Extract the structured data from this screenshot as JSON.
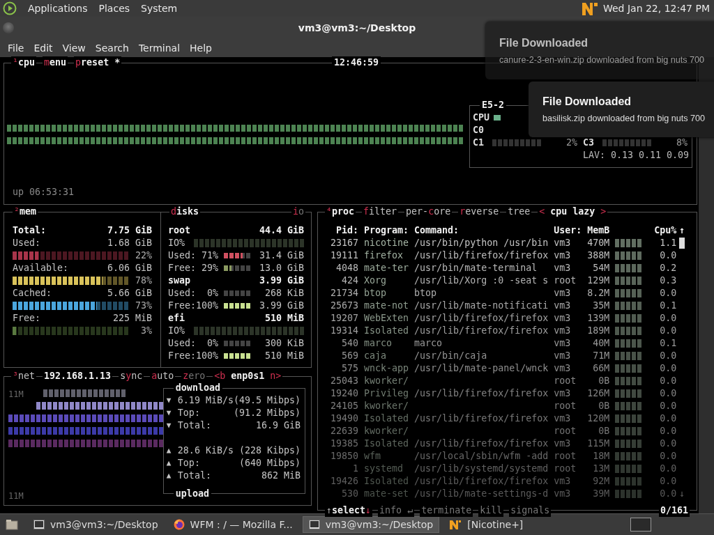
{
  "top_panel": {
    "menus": [
      "Applications",
      "Places",
      "System"
    ],
    "clock": "Wed Jan 22, 12:47 PM"
  },
  "window": {
    "title": "vm3@vm3:~/Desktop",
    "menu": [
      "File",
      "Edit",
      "View",
      "Search",
      "Terminal",
      "Help"
    ]
  },
  "cpu": {
    "tabs": [
      {
        "key": "¹",
        "post": "cpu"
      },
      {
        "key": "m",
        "post": "enu"
      },
      {
        "key": "p",
        "post": "reset *"
      }
    ],
    "clock": "12:46:59",
    "uptime": "up 06:53:31",
    "info": {
      "model": "E5-2",
      "cpu_label": "CPU",
      "c0_label": "C0",
      "cores": [
        {
          "label": "C1",
          "reading": "2%"
        },
        {
          "label": "C3",
          "reading": "8%"
        }
      ],
      "load": "LAV: 0.13 0.11 0.09"
    }
  },
  "notifications": [
    {
      "title": "File Downloaded",
      "body": "canure-2-3-en-win.zip downloaded from big nuts 700"
    },
    {
      "title": "File Downloaded",
      "body": "basilisk.zip downloaded from big nuts 700"
    }
  ],
  "mem": {
    "tab": {
      "key": "²",
      "post": "mem"
    },
    "rows": [
      {
        "kind": "total",
        "label": "Total:",
        "value": "7.75 GiB"
      },
      {
        "kind": "stat",
        "label": "Used:",
        "value": "1.68 GiB"
      },
      {
        "kind": "meter",
        "level": 0.22,
        "reading": "22%",
        "color": "#a8344a"
      },
      {
        "kind": "stat",
        "label": "Available:",
        "value": "6.06 GiB"
      },
      {
        "kind": "meter",
        "level": 0.78,
        "reading": "78%",
        "color": "#d9c25a"
      },
      {
        "kind": "stat",
        "label": "Cached:",
        "value": "5.66 GiB"
      },
      {
        "kind": "meter",
        "level": 0.73,
        "reading": "73%",
        "color": "#4aa6de"
      },
      {
        "kind": "stat",
        "label": "Free:",
        "value": "225 MiB"
      },
      {
        "kind": "meter",
        "level": 0.03,
        "reading": "3%",
        "color": "#5a7a40"
      }
    ]
  },
  "disks": {
    "tab": {
      "key": "d",
      "post": "isks"
    },
    "io_tab": {
      "key": "i",
      "post": "o"
    },
    "rows": [
      {
        "kind": "header",
        "label": "root",
        "value": "44.4 GiB"
      },
      {
        "kind": "io",
        "label": "IO%"
      },
      {
        "kind": "usage",
        "label": "Used:",
        "pct": "71%",
        "level": 0.71,
        "color": "#d05060",
        "value": "31.4 GiB"
      },
      {
        "kind": "usage",
        "label": "Free:",
        "pct": "29%",
        "level": 0.29,
        "color": "#8a9a60",
        "value": "13.0 GiB"
      },
      {
        "kind": "header",
        "label": "swap",
        "value": "3.99 GiB"
      },
      {
        "kind": "usage",
        "label": "Used:",
        "pct": "0%",
        "level": 0,
        "value": "268 KiB"
      },
      {
        "kind": "usage",
        "label": "Free:",
        "pct": "100%",
        "level": 1,
        "color": "#c8e090",
        "value": "3.99 GiB"
      },
      {
        "kind": "header",
        "label": "efi",
        "value": "510 MiB"
      },
      {
        "kind": "io",
        "label": "IO%"
      },
      {
        "kind": "usage",
        "label": "Used:",
        "pct": "0%",
        "level": 0,
        "value": "300 KiB"
      },
      {
        "kind": "usage",
        "label": "Free:",
        "pct": "100%",
        "level": 1,
        "color": "#c8e090",
        "value": "510 MiB"
      }
    ]
  },
  "net": {
    "tabs": [
      {
        "key": "³",
        "post": "net"
      },
      {
        "post": "192.168.1.13",
        "bold": true
      },
      {
        "pre": "s",
        "key": "y",
        "post": "nc"
      },
      {
        "key": "a",
        "post": "uto"
      },
      {
        "key": "z",
        "post": "ero",
        "dim": true
      },
      {
        "key": "<b ",
        "post": "enp0s1",
        "end": " n>",
        "bold": true
      }
    ],
    "scale_top": "11M",
    "scale_bottom": "11M",
    "download": {
      "title": "download",
      "rows": [
        {
          "arrow": "▼",
          "label": "6.19 MiB/s",
          "value": "(49.5 Mibps)"
        },
        {
          "arrow": "▼",
          "label": "Top:",
          "value": "(91.2 Mibps)"
        },
        {
          "arrow": "▼",
          "label": "Total:",
          "value": "16.9 GiB"
        }
      ]
    },
    "upload": {
      "title": "upload",
      "rows": [
        {
          "arrow": "▲",
          "label": "28.6 KiB/s",
          "value": "(228 Kibps)"
        },
        {
          "arrow": "▲",
          "label": "Top:",
          "value": "(640 Mibps)"
        },
        {
          "arrow": "▲",
          "label": "Total:",
          "value": "862 MiB"
        }
      ]
    }
  },
  "proc": {
    "tabs": [
      {
        "key": "⁴",
        "post": "proc",
        "bold": true
      },
      {
        "key": "f",
        "post": "ilter"
      },
      {
        "pre": "per-",
        "key": "c",
        "post": "ore"
      },
      {
        "key": "r",
        "post": "everse"
      },
      {
        "post": "tree"
      },
      {
        "key": "< ",
        "post": "cpu lazy",
        "end": " >",
        "bold": true
      }
    ],
    "columns": [
      "Pid:",
      "Program:",
      "Command:",
      "User:",
      "MemB",
      "Cpu%"
    ],
    "scroll_up": "↑",
    "scroll_down": "↓",
    "rows": [
      {
        "pid": "23167",
        "program": "nicotine",
        "command": "/usr/bin/python /usr/bin",
        "user": "vm3",
        "mem": "470M",
        "cpu": "1.1"
      },
      {
        "pid": "19111",
        "program": "firefox",
        "command": "/usr/lib/firefox/firefox",
        "user": "vm3",
        "mem": "388M",
        "cpu": "0.0"
      },
      {
        "pid": "4048",
        "program": "mate-ter",
        "command": "/usr/bin/mate-terminal",
        "user": "vm3",
        "mem": "54M",
        "cpu": "0.2"
      },
      {
        "pid": "424",
        "program": "Xorg",
        "command": "/usr/lib/Xorg :0 -seat s",
        "user": "root",
        "mem": "129M",
        "cpu": "0.3"
      },
      {
        "pid": "21734",
        "program": "btop",
        "command": "btop",
        "user": "vm3",
        "mem": "8.2M",
        "cpu": "0.0"
      },
      {
        "pid": "25673",
        "program": "mate-not",
        "command": "/usr/lib/mate-notificati",
        "user": "vm3",
        "mem": "35M",
        "cpu": "0.1"
      },
      {
        "pid": "19207",
        "program": "WebExten",
        "command": "/usr/lib/firefox/firefox",
        "user": "vm3",
        "mem": "139M",
        "cpu": "0.0"
      },
      {
        "pid": "19314",
        "program": "Isolated",
        "command": "/usr/lib/firefox/firefox",
        "user": "vm3",
        "mem": "189M",
        "cpu": "0.0"
      },
      {
        "pid": "540",
        "program": "marco",
        "command": "marco",
        "user": "vm3",
        "mem": "40M",
        "cpu": "0.1"
      },
      {
        "pid": "569",
        "program": "caja",
        "command": "/usr/bin/caja",
        "user": "vm3",
        "mem": "71M",
        "cpu": "0.0"
      },
      {
        "pid": "575",
        "program": "wnck-app",
        "command": "/usr/lib/mate-panel/wnck",
        "user": "vm3",
        "mem": "66M",
        "cpu": "0.0"
      },
      {
        "pid": "25043",
        "program": "kworker/",
        "command": "",
        "user": "root",
        "mem": "0B",
        "cpu": "0.0"
      },
      {
        "pid": "19240",
        "program": "Privileg",
        "command": "/usr/lib/firefox/firefox",
        "user": "vm3",
        "mem": "126M",
        "cpu": "0.0"
      },
      {
        "pid": "24105",
        "program": "kworker/",
        "command": "",
        "user": "root",
        "mem": "0B",
        "cpu": "0.0"
      },
      {
        "pid": "19490",
        "program": "Isolated",
        "command": "/usr/lib/firefox/firefox",
        "user": "vm3",
        "mem": "120M",
        "cpu": "0.0"
      },
      {
        "pid": "22639",
        "program": "kworker/",
        "command": "",
        "user": "root",
        "mem": "0B",
        "cpu": "0.0"
      },
      {
        "pid": "19385",
        "program": "Isolated",
        "command": "/usr/lib/firefox/firefox",
        "user": "vm3",
        "mem": "115M",
        "cpu": "0.0"
      },
      {
        "pid": "19850",
        "program": "wfm",
        "command": "/usr/local/sbin/wfm -add",
        "user": "root",
        "mem": "18M",
        "cpu": "0.0"
      },
      {
        "pid": "1",
        "program": "systemd",
        "command": "/usr/lib/systemd/systemd",
        "user": "root",
        "mem": "13M",
        "cpu": "0.0"
      },
      {
        "pid": "19426",
        "program": "Isolated",
        "command": "/usr/lib/firefox/firefox",
        "user": "vm3",
        "mem": "92M",
        "cpu": "0.0"
      },
      {
        "pid": "530",
        "program": "mate-set",
        "command": "/usr/lib/mate-settings-d",
        "user": "vm3",
        "mem": "39M",
        "cpu": "0.0"
      }
    ],
    "select": {
      "up": "↑",
      "label": "select",
      "down": "↓"
    },
    "actions": [
      "info ↵",
      "terminate",
      "kill",
      "signals"
    ],
    "count": "0/161"
  },
  "taskbar": [
    {
      "kind": "terminal",
      "label": "vm3@vm3:~/Desktop",
      "selected": false
    },
    {
      "kind": "browser",
      "label": "WFM : / — Mozilla F...",
      "selected": false
    },
    {
      "kind": "terminal",
      "label": "vm3@vm3:~/Desktop",
      "selected": true
    },
    {
      "kind": "nicotine",
      "label": "[Nicotine+]",
      "selected": false
    }
  ]
}
